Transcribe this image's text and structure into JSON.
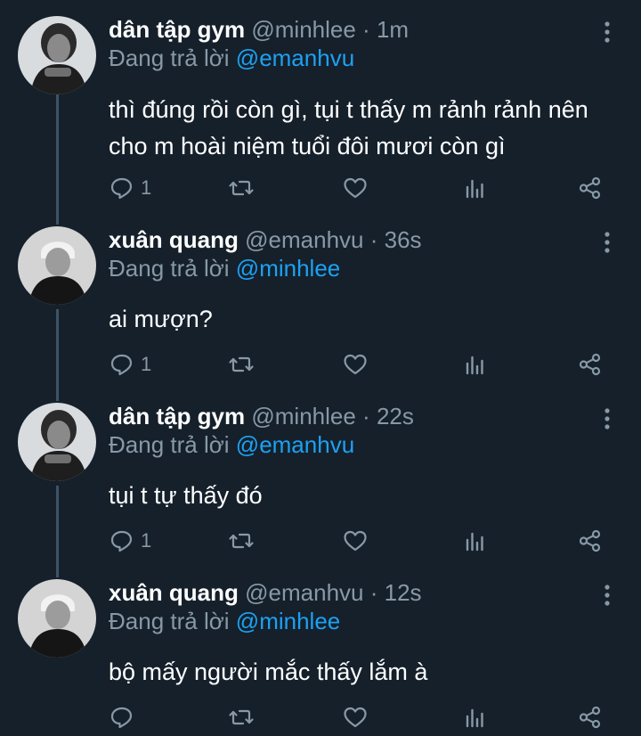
{
  "tweets": [
    {
      "display_name": "dân tập gym",
      "handle": "@minhlee",
      "time": "1m",
      "reply_prefix": "Đang trả lời",
      "reply_to": "@emanhvu",
      "text": "thì đúng rồi còn gì, tụi t thấy m rảnh rảnh nên\ncho m hoài niệm tuổi đôi mươi còn gì",
      "reply_count": "1",
      "avatar_icon": "profile-photo-icon"
    },
    {
      "display_name": "xuân quang",
      "handle": "@emanhvu",
      "time": "36s",
      "reply_prefix": "Đang trả lời",
      "reply_to": "@minhlee",
      "text": "ai mượn?",
      "reply_count": "1",
      "avatar_icon": "profile-photo-icon"
    },
    {
      "display_name": "dân tập gym",
      "handle": "@minhlee",
      "time": "22s",
      "reply_prefix": "Đang trả lời",
      "reply_to": "@emanhvu",
      "text": "tụi t tự thấy đó",
      "reply_count": "1",
      "avatar_icon": "profile-photo-icon"
    },
    {
      "display_name": "xuân quang",
      "handle": "@emanhvu",
      "time": "12s",
      "reply_prefix": "Đang trả lời",
      "reply_to": "@minhlee",
      "text": "bộ mấy người mắc thấy lắm à",
      "reply_count": "",
      "avatar_icon": "profile-photo-icon"
    }
  ],
  "meta_separator": " · ",
  "colors": {
    "background": "#15202b",
    "text_primary": "#ffffff",
    "text_secondary": "#8899a6",
    "link": "#1da1f2",
    "thread_line": "#3d5466"
  },
  "icons": {
    "reply": "reply-icon",
    "retweet": "retweet-icon",
    "like": "heart-icon",
    "analytics": "analytics-icon",
    "share": "share-icon",
    "more": "more-vertical-icon"
  }
}
